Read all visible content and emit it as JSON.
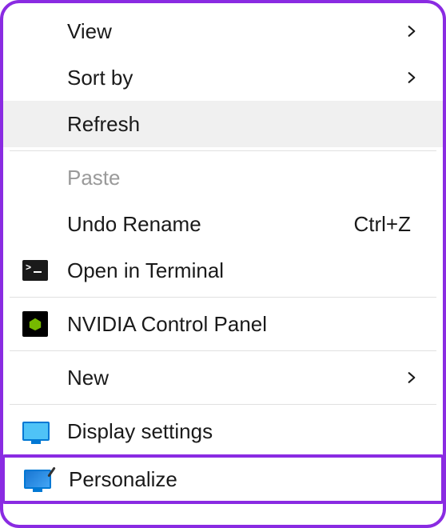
{
  "menu": {
    "items": [
      {
        "label": "View",
        "hasSubmenu": true,
        "icon": null,
        "shortcut": null,
        "disabled": false,
        "hovered": false,
        "highlighted": false
      },
      {
        "label": "Sort by",
        "hasSubmenu": true,
        "icon": null,
        "shortcut": null,
        "disabled": false,
        "hovered": false,
        "highlighted": false
      },
      {
        "label": "Refresh",
        "hasSubmenu": false,
        "icon": null,
        "shortcut": null,
        "disabled": false,
        "hovered": true,
        "highlighted": false
      },
      {
        "separator": true
      },
      {
        "label": "Paste",
        "hasSubmenu": false,
        "icon": null,
        "shortcut": null,
        "disabled": true,
        "hovered": false,
        "highlighted": false
      },
      {
        "label": "Undo Rename",
        "hasSubmenu": false,
        "icon": null,
        "shortcut": "Ctrl+Z",
        "disabled": false,
        "hovered": false,
        "highlighted": false
      },
      {
        "label": "Open in Terminal",
        "hasSubmenu": false,
        "icon": "terminal",
        "shortcut": null,
        "disabled": false,
        "hovered": false,
        "highlighted": false
      },
      {
        "separator": true
      },
      {
        "label": "NVIDIA Control Panel",
        "hasSubmenu": false,
        "icon": "nvidia",
        "shortcut": null,
        "disabled": false,
        "hovered": false,
        "highlighted": false
      },
      {
        "separator": true
      },
      {
        "label": "New",
        "hasSubmenu": true,
        "icon": null,
        "shortcut": null,
        "disabled": false,
        "hovered": false,
        "highlighted": false
      },
      {
        "separator": true
      },
      {
        "label": "Display settings",
        "hasSubmenu": false,
        "icon": "display",
        "shortcut": null,
        "disabled": false,
        "hovered": false,
        "highlighted": false
      },
      {
        "label": "Personalize",
        "hasSubmenu": false,
        "icon": "personalize",
        "shortcut": null,
        "disabled": false,
        "hovered": false,
        "highlighted": true
      }
    ]
  }
}
